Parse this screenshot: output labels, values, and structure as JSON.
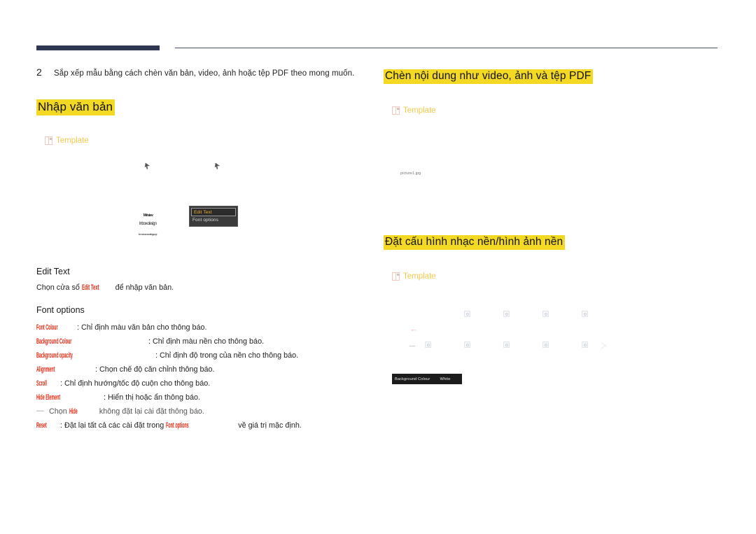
{
  "document": {
    "step_number": "2",
    "step_text": "Sắp xếp mẫu bằng cách chèn văn bản, video, ảnh hoặc tệp PDF theo mong muốn.",
    "template_label": "Template"
  },
  "headings": {
    "nhap_van_ban": "Nhập văn bản",
    "chen_noi_dung": "Chèn nội dung như video, ảnh và tệp PDF",
    "dat_cau_hinh": "Đặt cấu hình nhạc nền/hình ảnh nền",
    "edit_text": "Edit Text",
    "font_options": "Font options"
  },
  "left_column": {
    "intro_before": "Chọn cửa sổ ",
    "intro_label": "Edit Text",
    "intro_after": " để nhập văn bản.",
    "context_menu": {
      "items": [
        "Edit Text",
        "Font options"
      ]
    },
    "mini_screenshot": {
      "line1": "Main view",
      "line2": "Inbox design",
      "line3": "the main window settings page"
    },
    "options": [
      {
        "label": "Font Colour",
        "width": "lbl-w1",
        "desc": ": Chỉ định màu văn bản cho thông báo."
      },
      {
        "label": "Background Colour",
        "width": "lbl-w2",
        "desc": ": Chỉ định màu nền cho thông báo."
      },
      {
        "label": "Background opacity",
        "width": "lbl-w3",
        "desc": ": Chỉ định độ trong của nền cho thông báo."
      },
      {
        "label": "Alignment",
        "width": "lbl-w4",
        "desc": ": Chọn chế độ căn chỉnh thông báo."
      },
      {
        "label": "Scroll",
        "width": "lbl-w5",
        "desc": ": Chỉ định hướng/tốc độ cuộn cho thông báo."
      },
      {
        "label": "Hide Element",
        "width": "lbl-w6",
        "desc": ": Hiển thị hoặc ẩn thông báo."
      }
    ],
    "sub_note": {
      "dash": "—",
      "before": "Chọn ",
      "label": "Hide",
      "after": " không đặt lại cài đặt thông báo."
    },
    "reset_row": {
      "label": "Reset",
      "mid": ": Đặt lại tất cả các cài đặt trong ",
      "label2": "Font options",
      "after": " về giá trị mặc định."
    }
  },
  "right_column": {
    "picture_file": "picture1.jpg",
    "background_bar": {
      "key": "Background Colour",
      "value": "White"
    }
  },
  "colors": {
    "highlight": "#f3d923",
    "rule_navy": "#2e3652",
    "accent_red": "#e8270f",
    "template_gold": "#f2c94c"
  }
}
